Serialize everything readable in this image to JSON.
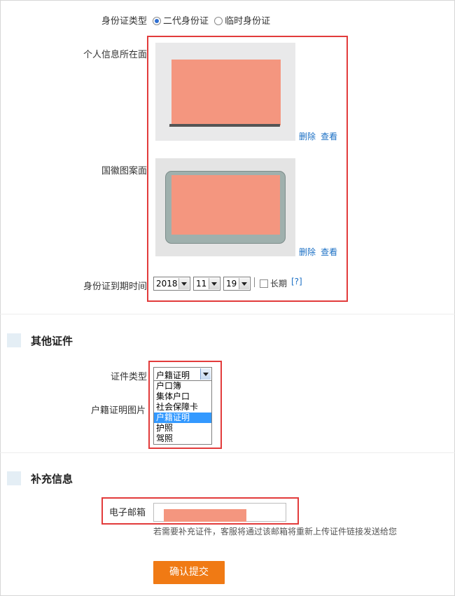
{
  "id_type": {
    "label": "身份证类型",
    "options": [
      "二代身份证",
      "临时身份证"
    ],
    "selected": "二代身份证"
  },
  "front_side": {
    "label": "个人信息所在面",
    "delete_label": "删除",
    "view_label": "查看"
  },
  "back_side": {
    "label": "国徽图案面",
    "delete_label": "删除",
    "view_label": "查看"
  },
  "expiry": {
    "label": "身份证到期时间",
    "year": "2018",
    "month": "11",
    "day": "19",
    "long_term_label": "长期",
    "help_label": "[?]"
  },
  "other_docs": {
    "section_title": "其他证件",
    "doc_type_label": "证件类型",
    "doc_type_selected": "户籍证明",
    "doc_type_options": [
      "户口簿",
      "集体户口",
      "社会保障卡",
      "户籍证明",
      "护照",
      "驾照"
    ],
    "image_label": "户籍证明图片"
  },
  "extra_info": {
    "section_title": "补充信息",
    "email_label": "电子邮箱",
    "email_value": "",
    "hint": "若需要补充证件，客服将通过该邮箱将重新上传证件链接发送给您"
  },
  "submit_label": "确认提交",
  "colors": {
    "highlight_border": "#e23b3b",
    "link": "#1a6fc4",
    "submit_bg": "#f07a14",
    "redacted": "#f4967f",
    "dropdown_selected": "#3399ff"
  }
}
